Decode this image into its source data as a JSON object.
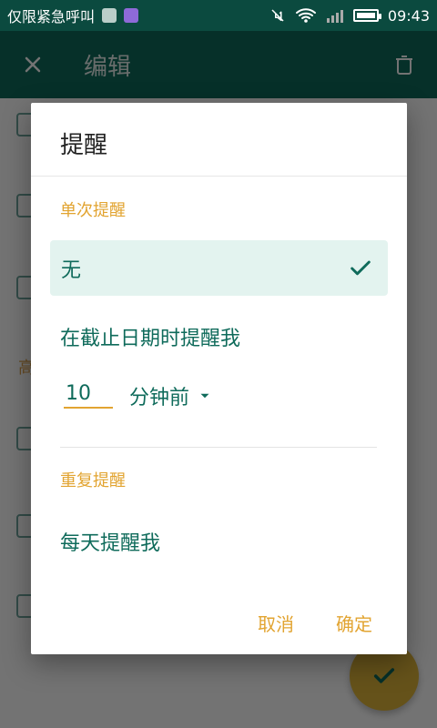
{
  "status_bar": {
    "carrier_text": "仅限紧急呼叫",
    "time": "09:43",
    "icons": [
      "gallery-icon",
      "message-icon",
      "mute-icon",
      "wifi-icon",
      "signal-icon",
      "battery-icon"
    ]
  },
  "app_bar": {
    "title": "编辑",
    "icons": [
      "close-icon",
      "trash-icon"
    ]
  },
  "dialog": {
    "title": "提醒",
    "section_single": "单次提醒",
    "selected_option": "无",
    "option_deadline": "在截止日期时提醒我",
    "minutes_value": "10",
    "unit_selected": "分钟前",
    "section_repeat": "重复提醒",
    "option_daily": "每天提醒我",
    "actions": {
      "cancel": "取消",
      "ok": "确定"
    }
  },
  "colors": {
    "status_bar_bg": "#0b4a3f",
    "app_bar_bg": "#0f6b5b",
    "accent_orange": "#e2a431",
    "primary_green": "#0f6b5b",
    "selected_bg": "#e3f3ef",
    "fab_bg": "#e0b53a"
  },
  "underlying_section_hint": "高"
}
